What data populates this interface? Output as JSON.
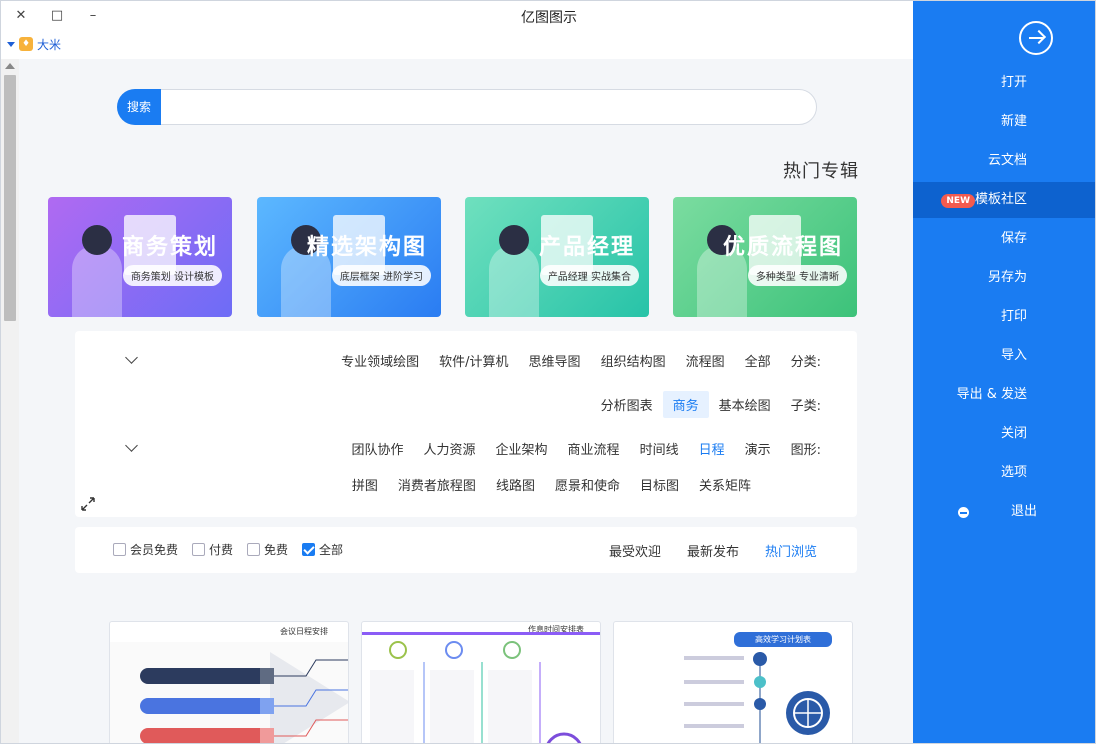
{
  "window": {
    "title": "亿图图示",
    "controls": [
      "✕",
      "□",
      "–"
    ]
  },
  "user": {
    "name": "大米"
  },
  "search": {
    "button": "搜索",
    "placeholder": ""
  },
  "hot": {
    "title": "热门专辑",
    "banners": [
      {
        "title": "优质流程图",
        "subtitle": "多种类型 专业清晰",
        "color1": "#7bdca0",
        "color2": "#3cc27a"
      },
      {
        "title": "产品经理",
        "subtitle": "产品经理 实战集合",
        "color1": "#6fe0be",
        "color2": "#27c3a8"
      },
      {
        "title": "精选架构图",
        "subtitle": "底层框架 进阶学习",
        "color1": "#5cb8ff",
        "color2": "#2a7cf2"
      },
      {
        "title": "商务策划",
        "subtitle": "商务策划 设计模板",
        "color1": "#b06af2",
        "color2": "#6d6cf6"
      }
    ]
  },
  "filters": {
    "category": {
      "label": "分类:",
      "items": [
        "全部",
        "流程图",
        "组织结构图",
        "思维导图",
        "软件/计算机",
        "专业领域绘图"
      ]
    },
    "subcategory": {
      "label": "子类:",
      "items": [
        "基本绘图",
        "商务",
        "分析图表"
      ],
      "selected": "商务"
    },
    "shape": {
      "label": "图形:",
      "row1": [
        "演示",
        "日程",
        "时间线",
        "商业流程",
        "企业架构",
        "人力资源",
        "团队协作"
      ],
      "row2": [
        "关系矩阵",
        "目标图",
        "愿景和使命",
        "线路图",
        "消费者旅程图",
        "拼图"
      ],
      "highlight": "日程"
    }
  },
  "tabs": {
    "items": [
      "热门浏览",
      "最新发布",
      "最受欢迎"
    ],
    "active": "热门浏览"
  },
  "price_filters": [
    {
      "label": "全部",
      "checked": true
    },
    {
      "label": "免费",
      "checked": false
    },
    {
      "label": "付费",
      "checked": false
    },
    {
      "label": "会员免费",
      "checked": false
    }
  ],
  "templates": [
    {
      "title": "高效学习计划表"
    },
    {
      "title": "作息时间安排表"
    },
    {
      "title": "会议日程安排"
    }
  ],
  "sidebar": {
    "items": [
      {
        "label": "打开"
      },
      {
        "label": "新建"
      },
      {
        "label": "云文档"
      },
      {
        "label": "模板社区",
        "badge": "NEW",
        "active": true
      },
      {
        "label": "保存"
      },
      {
        "label": "另存为"
      },
      {
        "label": "打印"
      },
      {
        "label": "导入"
      },
      {
        "label": "导出 & 发送"
      },
      {
        "label": "关闭"
      },
      {
        "label": "选项"
      },
      {
        "label": "退出"
      }
    ]
  },
  "colors": {
    "accent": "#1a7cf2",
    "sidebar": "#1a7cf2",
    "new_badge": "#f35b4f"
  }
}
